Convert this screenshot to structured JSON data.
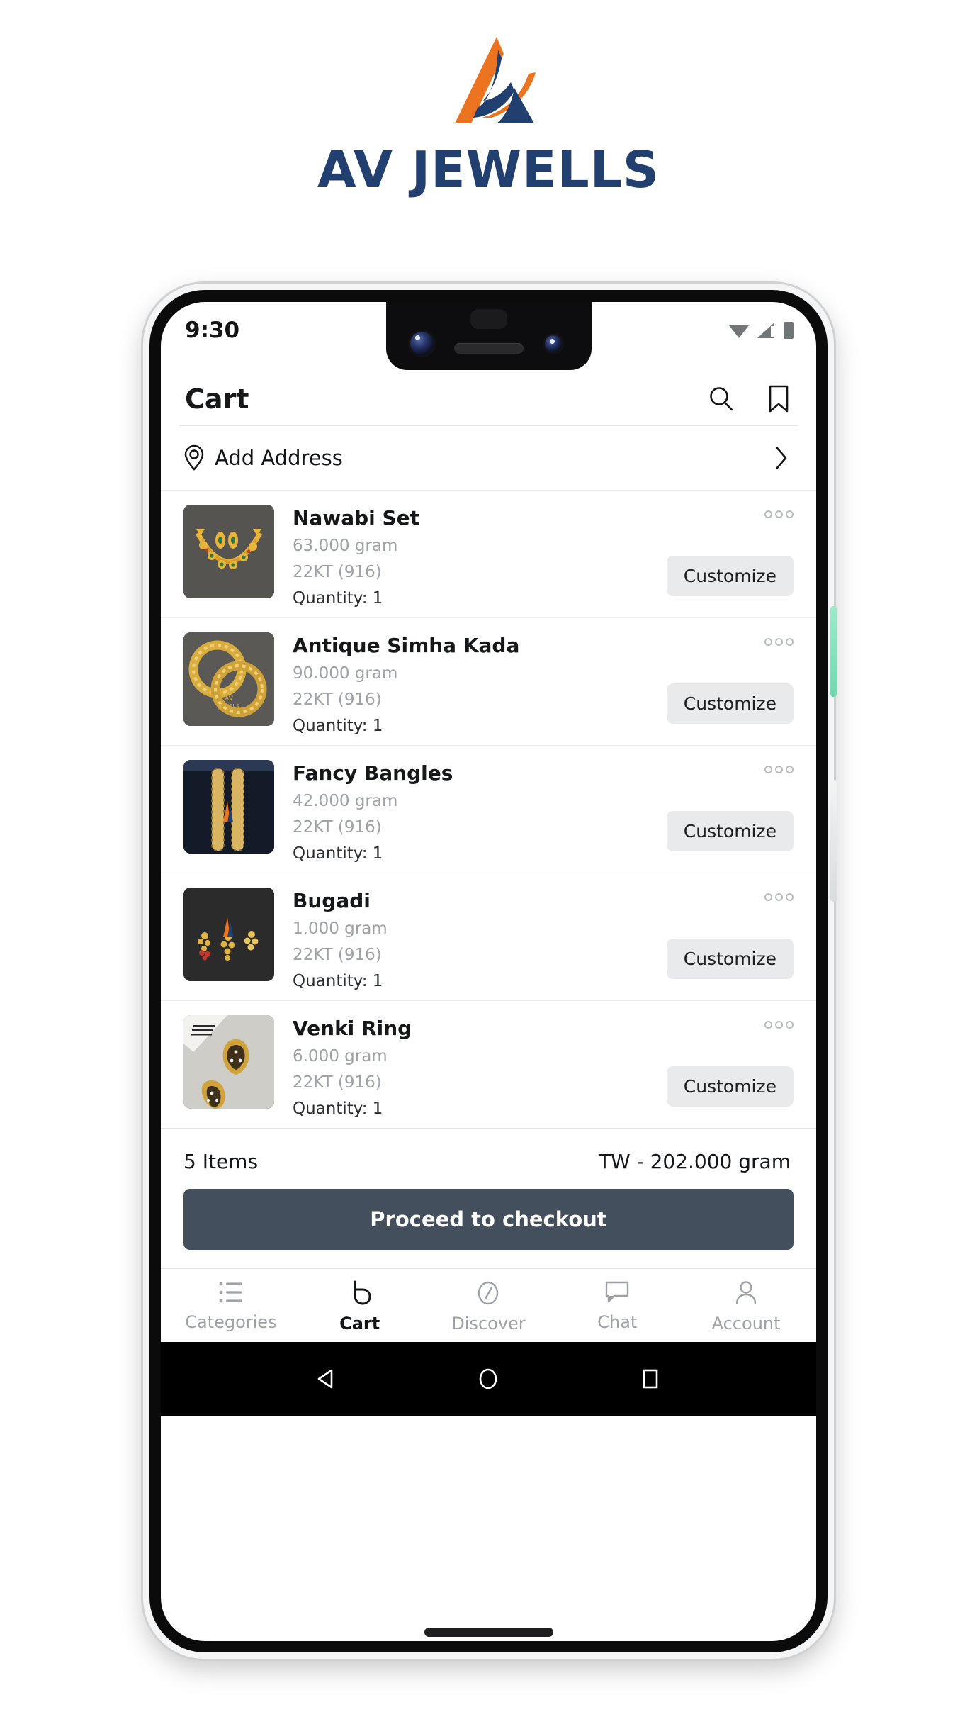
{
  "brand": {
    "name": "AV JEWELLS",
    "logo_icon": "av-triangle-logo",
    "orange": "#ec7320",
    "navy": "#21406f"
  },
  "statusbar": {
    "time": "9:30",
    "icons": [
      "wifi-icon",
      "cellular-signal-icon",
      "battery-icon"
    ]
  },
  "appbar": {
    "title": "Cart",
    "search_icon": "search-icon",
    "bookmark_icon": "bookmark-icon"
  },
  "address": {
    "label": "Add Address",
    "pin_icon": "location-pin-icon",
    "chevron_icon": "chevron-right-icon"
  },
  "cart": {
    "items": [
      {
        "name": "Nawabi Set",
        "weight": "63.000 gram",
        "purity": "22KT (916)",
        "quantity": "Quantity: 1",
        "customize_label": "Customize",
        "menu_icon": "overflow-menu-icon",
        "thumb": "necklace-earrings-set"
      },
      {
        "name": "Antique Simha Kada",
        "weight": "90.000 gram",
        "purity": "22KT (916)",
        "quantity": "Quantity: 1",
        "customize_label": "Customize",
        "menu_icon": "overflow-menu-icon",
        "thumb": "antique-gold-bangles"
      },
      {
        "name": "Fancy Bangles",
        "weight": "42.000 gram",
        "purity": "22KT (916)",
        "quantity": "Quantity: 1",
        "customize_label": "Customize",
        "menu_icon": "overflow-menu-icon",
        "thumb": "fancy-bangles-pair"
      },
      {
        "name": "Bugadi",
        "weight": "1.000 gram",
        "purity": "22KT (916)",
        "quantity": "Quantity: 1",
        "customize_label": "Customize",
        "menu_icon": "overflow-menu-icon",
        "thumb": "bugadi-earrings"
      },
      {
        "name": "Venki Ring",
        "weight": "6.000 gram",
        "purity": "22KT (916)",
        "quantity": "Quantity: 1",
        "customize_label": "Customize",
        "menu_icon": "overflow-menu-icon",
        "thumb": "venki-ring-pair"
      }
    ]
  },
  "summary": {
    "items_count": "5 Items",
    "total_weight": "TW - 202.000 gram",
    "checkout_label": "Proceed to checkout",
    "checkout_color": "#434f5d"
  },
  "bottomnav": {
    "items": [
      {
        "label": "Categories",
        "icon": "list-icon",
        "active": false
      },
      {
        "label": "Cart",
        "icon": "shopping-bag-icon",
        "active": true
      },
      {
        "label": "Discover",
        "icon": "compass-icon",
        "active": false
      },
      {
        "label": "Chat",
        "icon": "chat-bubble-icon",
        "active": false
      },
      {
        "label": "Account",
        "icon": "person-icon",
        "active": false
      }
    ]
  },
  "androidnav": {
    "back_icon": "back-triangle-icon",
    "home_icon": "home-circle-icon",
    "recents_icon": "recents-square-icon"
  }
}
